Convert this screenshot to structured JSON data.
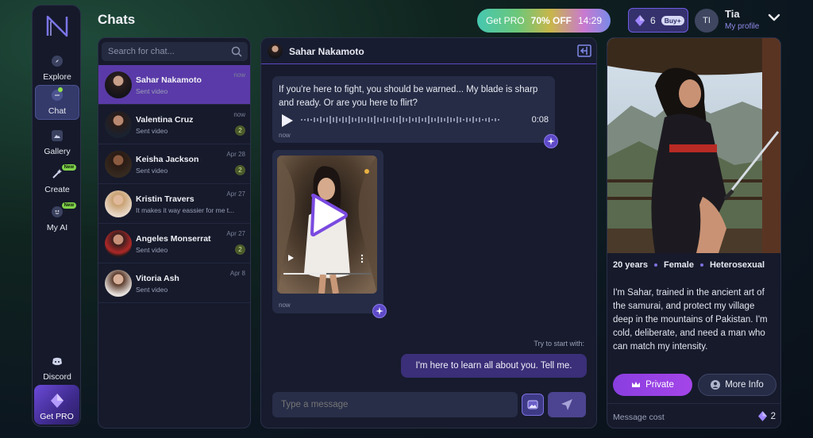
{
  "header": {
    "title": "Chats",
    "promo": {
      "label": "Get PRO",
      "discount": "70% OFF",
      "timer": "14:29"
    },
    "gems": {
      "count": "6",
      "buy_label": "Buy+"
    },
    "profile": {
      "initials": "TI",
      "name": "Tia",
      "link": "My profile"
    }
  },
  "nav": {
    "items": [
      {
        "label": "Explore",
        "icon": "compass-icon"
      },
      {
        "label": "Chat",
        "icon": "chat-bubble-icon",
        "active": true
      },
      {
        "label": "Gallery",
        "icon": "image-icon"
      },
      {
        "label": "Create",
        "icon": "magic-wand-icon",
        "badge": "New"
      },
      {
        "label": "My AI",
        "icon": "ai-face-icon",
        "badge": "New"
      }
    ],
    "discord_label": "Discord",
    "getpro_label": "Get PRO"
  },
  "chat_list": {
    "search_placeholder": "Search for chat...",
    "items": [
      {
        "name": "Sahar Nakamoto",
        "preview": "Sent video",
        "time": "now",
        "unread": ""
      },
      {
        "name": "Valentina Cruz",
        "preview": "Sent video",
        "time": "now",
        "unread": "2"
      },
      {
        "name": "Keisha Jackson",
        "preview": "Sent video",
        "time": "Apr 28",
        "unread": "2"
      },
      {
        "name": "Kristin Travers",
        "preview": "It makes it way eassier for me t...",
        "time": "Apr 27",
        "unread": ""
      },
      {
        "name": "Angeles Monserrat",
        "preview": "Sent video",
        "time": "Apr 27",
        "unread": "2"
      },
      {
        "name": "Vitoria Ash",
        "preview": "Sent video",
        "time": "Apr 8",
        "unread": ""
      }
    ]
  },
  "conversation": {
    "contact_name": "Sahar Nakamoto",
    "audio_message": {
      "text": "If you're here to fight, you should be warned... My blade is sharp and ready. Or are you here to flirt?",
      "duration": "0:08",
      "time": "now"
    },
    "video_message": {
      "time": "now"
    },
    "try_label": "Try to start with:",
    "suggestion": "I'm here to learn all about you. Tell me.",
    "composer_placeholder": "Type a message"
  },
  "profile_card": {
    "age": "20 years",
    "gender": "Female",
    "orientation": "Heterosexual",
    "bio": "I'm Sahar, trained in the ancient art of the samurai, and protect my village deep in the mountains of Pakistan. I'm cold, deliberate, and need a man who can match my intensity.",
    "private_label": "Private",
    "more_info_label": "More Info",
    "cost_label": "Message cost",
    "cost_value": "2"
  },
  "colors": {
    "accent": "#5e49c8",
    "active_chat": "#5a3aa8",
    "private_button": "#9a42e6"
  }
}
